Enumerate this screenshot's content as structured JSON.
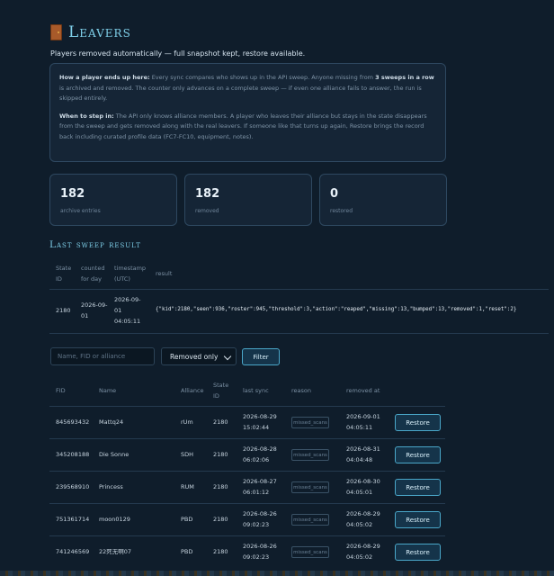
{
  "header": {
    "icon": "door-icon",
    "title": "Leavers",
    "subtitle": "Players removed automatically — full snapshot kept, restore available."
  },
  "info": {
    "p1_label": "How a player ends up here:",
    "p1_a": " Every sync compares who shows up in the API sweep. Anyone missing from ",
    "p1_bold": "3 sweeps in a row",
    "p1_b": " is archived and removed. The counter only advances on a complete sweep — if even one alliance fails to answer, the run is skipped entirely.",
    "p2_label": "When to step in:",
    "p2_text": " The API only knows alliance members. A player who leaves their alliance but stays in the state disappears from the sweep and gets removed along with the real leavers. If someone like that turns up again, Restore brings the record back including curated profile data (FC7-FC10, equipment, notes)."
  },
  "stats": [
    {
      "value": "182",
      "label": "archive entries"
    },
    {
      "value": "182",
      "label": "removed"
    },
    {
      "value": "0",
      "label": "restored"
    }
  ],
  "last_sweep": {
    "heading": "Last sweep result",
    "headers": {
      "state": "State ID",
      "counted": "counted for day",
      "timestamp": "timestamp (UTC)",
      "result": "result"
    },
    "row": {
      "state": "2180",
      "counted": "2026-09-01",
      "timestamp": "2026-09-01 04:05:11",
      "result": "{\"kid\":2180,\"seen\":936,\"roster\":945,\"threshold\":3,\"action\":\"reaped\",\"missing\":13,\"bumped\":13,\"removed\":1,\"reset\":2}"
    }
  },
  "filter": {
    "search_placeholder": "Name, FID or alliance",
    "select_value": "Removed only",
    "filter_label": "Filter"
  },
  "table": {
    "headers": {
      "fid": "FID",
      "name": "Name",
      "alliance": "Alliance",
      "state": "State ID",
      "last_sync": "last sync",
      "reason": "reason",
      "removed_at": "removed at"
    },
    "restore_label": "Restore",
    "rows": [
      {
        "fid": "845693432",
        "name": "Mattq24",
        "alliance": "rUm",
        "state": "2180",
        "last_sync": "2026-08-29 15:02:44",
        "reason": "missed_scans",
        "removed_at": "2026-09-01 04:05:11"
      },
      {
        "fid": "345208188",
        "name": "Die Sonne",
        "alliance": "SDH",
        "state": "2180",
        "last_sync": "2026-08-28 06:02:06",
        "reason": "missed_scans",
        "removed_at": "2026-08-31 04:04:48"
      },
      {
        "fid": "239568910",
        "name": "Princess",
        "alliance": "RUM",
        "state": "2180",
        "last_sync": "2026-08-27 06:01:12",
        "reason": "missed_scans",
        "removed_at": "2026-08-30 04:05:01"
      },
      {
        "fid": "751361714",
        "name": "moon0129",
        "alliance": "PBD",
        "state": "2180",
        "last_sync": "2026-08-26 09:02:23",
        "reason": "missed_scans",
        "removed_at": "2026-08-29 04:05:02"
      },
      {
        "fid": "741246569",
        "name": "22死无啊07",
        "alliance": "PBD",
        "state": "2180",
        "last_sync": "2026-08-26 09:02:23",
        "reason": "missed_scans",
        "removed_at": "2026-08-29 04:05:02"
      }
    ]
  }
}
